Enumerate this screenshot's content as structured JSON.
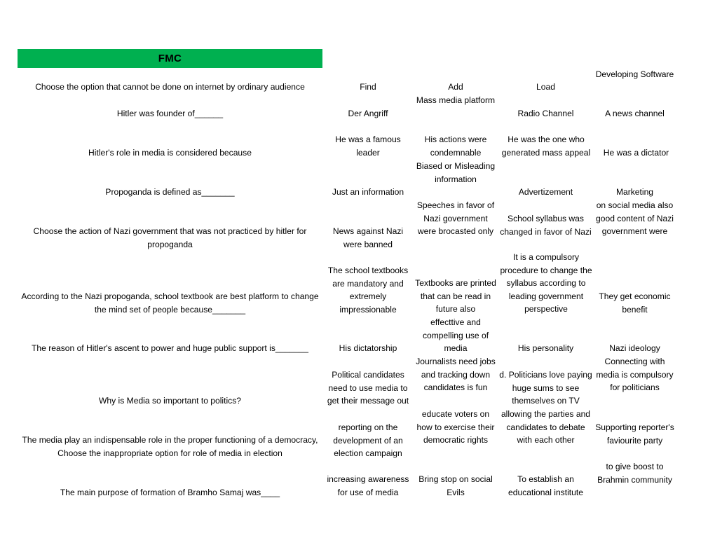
{
  "banner": {
    "title": "FMC",
    "color": "#00B050"
  },
  "sheet": {
    "rows": [
      {
        "question": "Choose the option that cannot be done on internet by ordinary audience",
        "options": [
          "Find",
          "Add",
          "Load",
          "Developing Software"
        ]
      },
      {
        "question": "Hitler was founder of______",
        "options": [
          "Der Angriff",
          "Mass media platform",
          "Radio Channel",
          "A news channel"
        ]
      },
      {
        "question": "Hitler's role in media is considered because",
        "options": [
          "He was a famous leader",
          "His actions were condemnable",
          "He was the one who generated mass appeal",
          "He was a dictator"
        ]
      },
      {
        "question": "Propoganda is defined as_______",
        "options": [
          "Just an information",
          "Biased or Misleading information",
          "Advertizement",
          "Marketing"
        ]
      },
      {
        "question": "Choose the action of Nazi government that was not practiced by hitler for propoganda",
        "options": [
          "News against Nazi were banned",
          "Speeches in favor of Nazi government were brocasted only",
          "School syllabus was changed in favor of Nazi",
          "on social media also good content of Nazi government were"
        ]
      },
      {
        "question": "According to the Nazi propoganda, school textbook are best platform to change the mind set of people because_______",
        "options": [
          "The school textbooks are mandatory and extremely impressionable",
          "Textbooks are printed that can be read in future also",
          "It is a compulsory procedure to change the syllabus according to leading government perspective",
          "They get economic benefit"
        ]
      },
      {
        "question": "The reason of Hitler's ascent to power and huge public support is_______",
        "options": [
          "His dictatorship",
          "effecttive and compelling use of media",
          "His personality",
          "Nazi ideology"
        ]
      },
      {
        "question": "Why is Media so important to politics?",
        "options": [
          "Political candidates need to use media to get their message out",
          "Journalists need jobs and tracking down candidates is fun",
          "d. Politicians love paying huge sums to see themselves on TV",
          "Connecting with media is compulsory for politicians"
        ]
      },
      {
        "question": "The media play an indispensable role in the proper functioning of a democracy, Choose the inappropriate option for role of media in election",
        "options": [
          "reporting on the development of an election campaign",
          "educate voters on how to exercise their democratic rights",
          "allowing the parties and candidates to debate with each other",
          "Supporting reporter's faviourite party"
        ]
      },
      {
        "question": "The main purpose of formation of Bramho Samaj was____",
        "options": [
          "increasing awareness for use of media",
          "Bring stop on social Evils",
          "To establish an educational institute",
          "to give boost to Brahmin community"
        ]
      }
    ]
  }
}
